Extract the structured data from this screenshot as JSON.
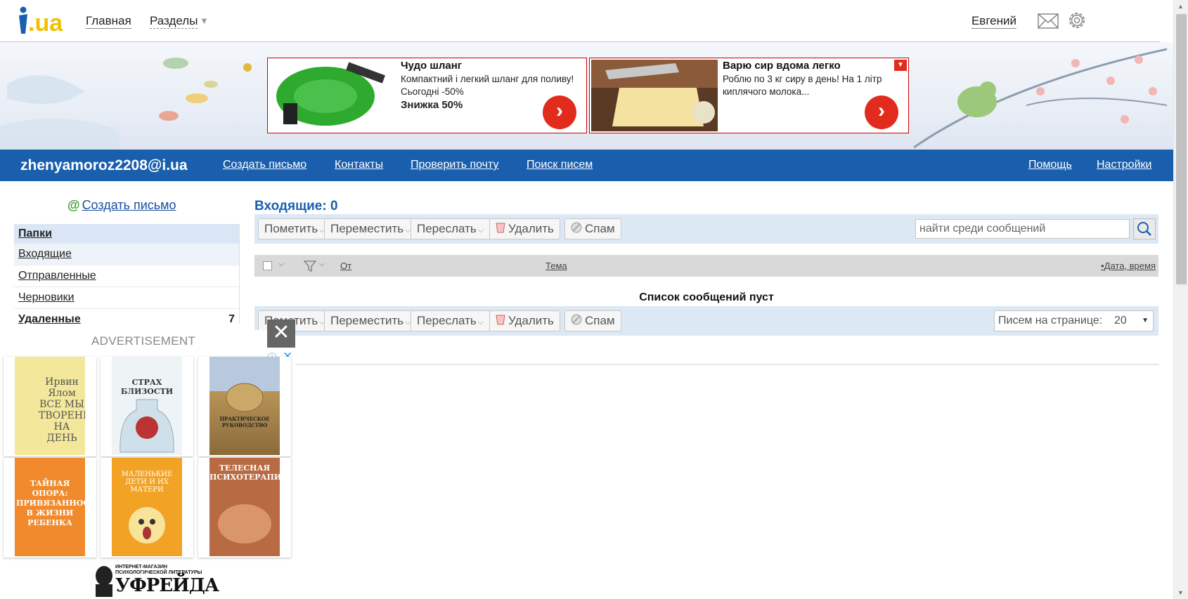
{
  "topbar": {
    "logo_text": "i.ua",
    "nav_home": "Главная",
    "nav_sections": "Разделы",
    "user_name": "Евгений"
  },
  "ads": [
    {
      "title": "Чудо шланг",
      "text": "Компактний і легкий шланг для поливу! Сьогодні -50%",
      "strong": "Знижка 50%"
    },
    {
      "title": "Варю сир вдома легко",
      "text": "Роблю по 3 кг сиру в день! На 1 літр киплячого молока...",
      "strong": ""
    }
  ],
  "bluebar": {
    "email": "zhenyamoroz2208@i.ua",
    "links": [
      "Создать письмо",
      "Контакты",
      "Проверить почту",
      "Поиск писем"
    ],
    "help": "Помощь",
    "settings": "Настройки"
  },
  "sidebar": {
    "compose": "Создать письмо",
    "folders_header": "Папки",
    "folders": [
      {
        "label": "Входящие",
        "count": ""
      },
      {
        "label": "Отправленные",
        "count": ""
      },
      {
        "label": "Черновики",
        "count": ""
      },
      {
        "label": "Удаленные",
        "count": "7"
      }
    ]
  },
  "main": {
    "title": "Входящие: 0",
    "toolbar": {
      "mark": "Пометить",
      "move": "Переместить",
      "forward": "Переслать",
      "delete": "Удалить",
      "spam": "Спам"
    },
    "search_placeholder": "найти среди сообщений",
    "columns": {
      "from": "От",
      "subject": "Тема",
      "date": "Дата, время"
    },
    "empty": "Список сообщений пуст",
    "per_page_label": "Писем на странице:",
    "per_page_value": "20"
  },
  "advert": {
    "label": "ADVERTISEMENT",
    "books": [
      {
        "title": "Ирвин Ялом ВСЕ МЫ ТВОРЕНИЯ НА ДЕНЬ"
      },
      {
        "title": "СТРАХ БЛИЗОСТИ"
      },
      {
        "title": "ПРАКТИЧЕСКОЕ РУКОВОДСТВО"
      },
      {
        "title": "ТАЙНАЯ ОПОРА: ПРИВЯЗАННОСТЬ В ЖИЗНИ РЕБЕНКА"
      },
      {
        "title": "МАЛЕНЬКИЕ ДЕТИ И ИХ МАТЕРИ"
      },
      {
        "title": "ТЕЛЕСНАЯ ПСИХОТЕРАПИЯ"
      }
    ],
    "brand_top": "ИНТЕРНЕТ-МАГАЗИН ПСИХОЛОГИЧЕСКОЙ ЛИТЕРАТУРЫ",
    "brand_name": "УФРЕЙДА"
  },
  "colors": {
    "brand_blue": "#1a5fad",
    "ad_red": "#e02b1d",
    "toolbar_bg": "#dde8f5"
  }
}
